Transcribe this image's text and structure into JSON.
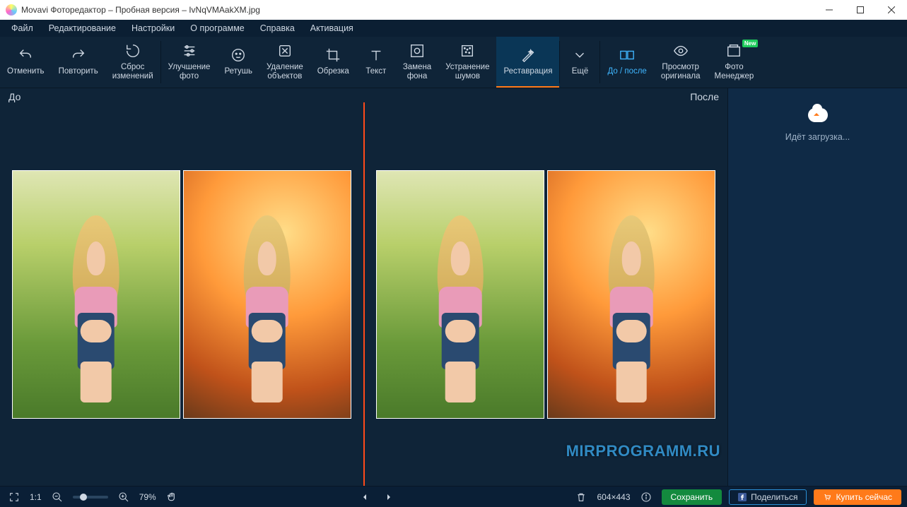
{
  "title": "Movavi Фоторедактор – Пробная версия – IvNqVMAakXM.jpg",
  "menu": {
    "file": "Файл",
    "edit": "Редактирование",
    "settings": "Настройки",
    "about": "О программе",
    "help": "Справка",
    "activate": "Активация"
  },
  "tools": {
    "undo": "Отменить",
    "redo": "Повторить",
    "reset": "Сброс\nизменений",
    "enhance": "Улучшение\nфото",
    "retouch": "Ретушь",
    "remove": "Удаление\nобъектов",
    "crop": "Обрезка",
    "text": "Текст",
    "bg": "Замена\nфона",
    "noise": "Устранение\nшумов",
    "restore": "Реставрация",
    "more": "Ещё",
    "beforeafter": "До / после",
    "original": "Просмотр\nоригинала",
    "manager": "Фото\nМенеджер",
    "new": "New"
  },
  "viewer": {
    "before": "До",
    "after": "После"
  },
  "side": {
    "loading": "Идёт загрузка..."
  },
  "status": {
    "scale": "1:1",
    "zoom": "79%",
    "dims": "604×443",
    "save": "Сохранить",
    "share": "Поделиться",
    "buy": "Купить сейчас"
  },
  "watermark": "MIRPROGRAMM.RU"
}
